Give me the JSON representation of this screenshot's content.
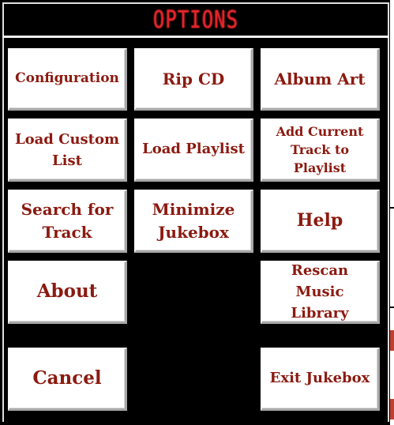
{
  "title": "OPTIONS",
  "buttons": {
    "configuration": "Configuration",
    "rip_cd": "Rip CD",
    "album_art": "Album Art",
    "load_custom_list": "Load Custom List",
    "load_playlist": "Load Playlist",
    "add_current_track": "Add Current Track to Playlist",
    "search_for_track": "Search for Track",
    "minimize_jukebox": "Minimize Jukebox",
    "help": "Help",
    "about": "About",
    "rescan_music_library": "Rescan Music Library",
    "cancel": "Cancel",
    "exit_jukebox": "Exit Jukebox"
  },
  "colors": {
    "title": "#e3242b",
    "button_text": "#8b1a10",
    "button_face": "#ffffff",
    "background": "#000000"
  }
}
